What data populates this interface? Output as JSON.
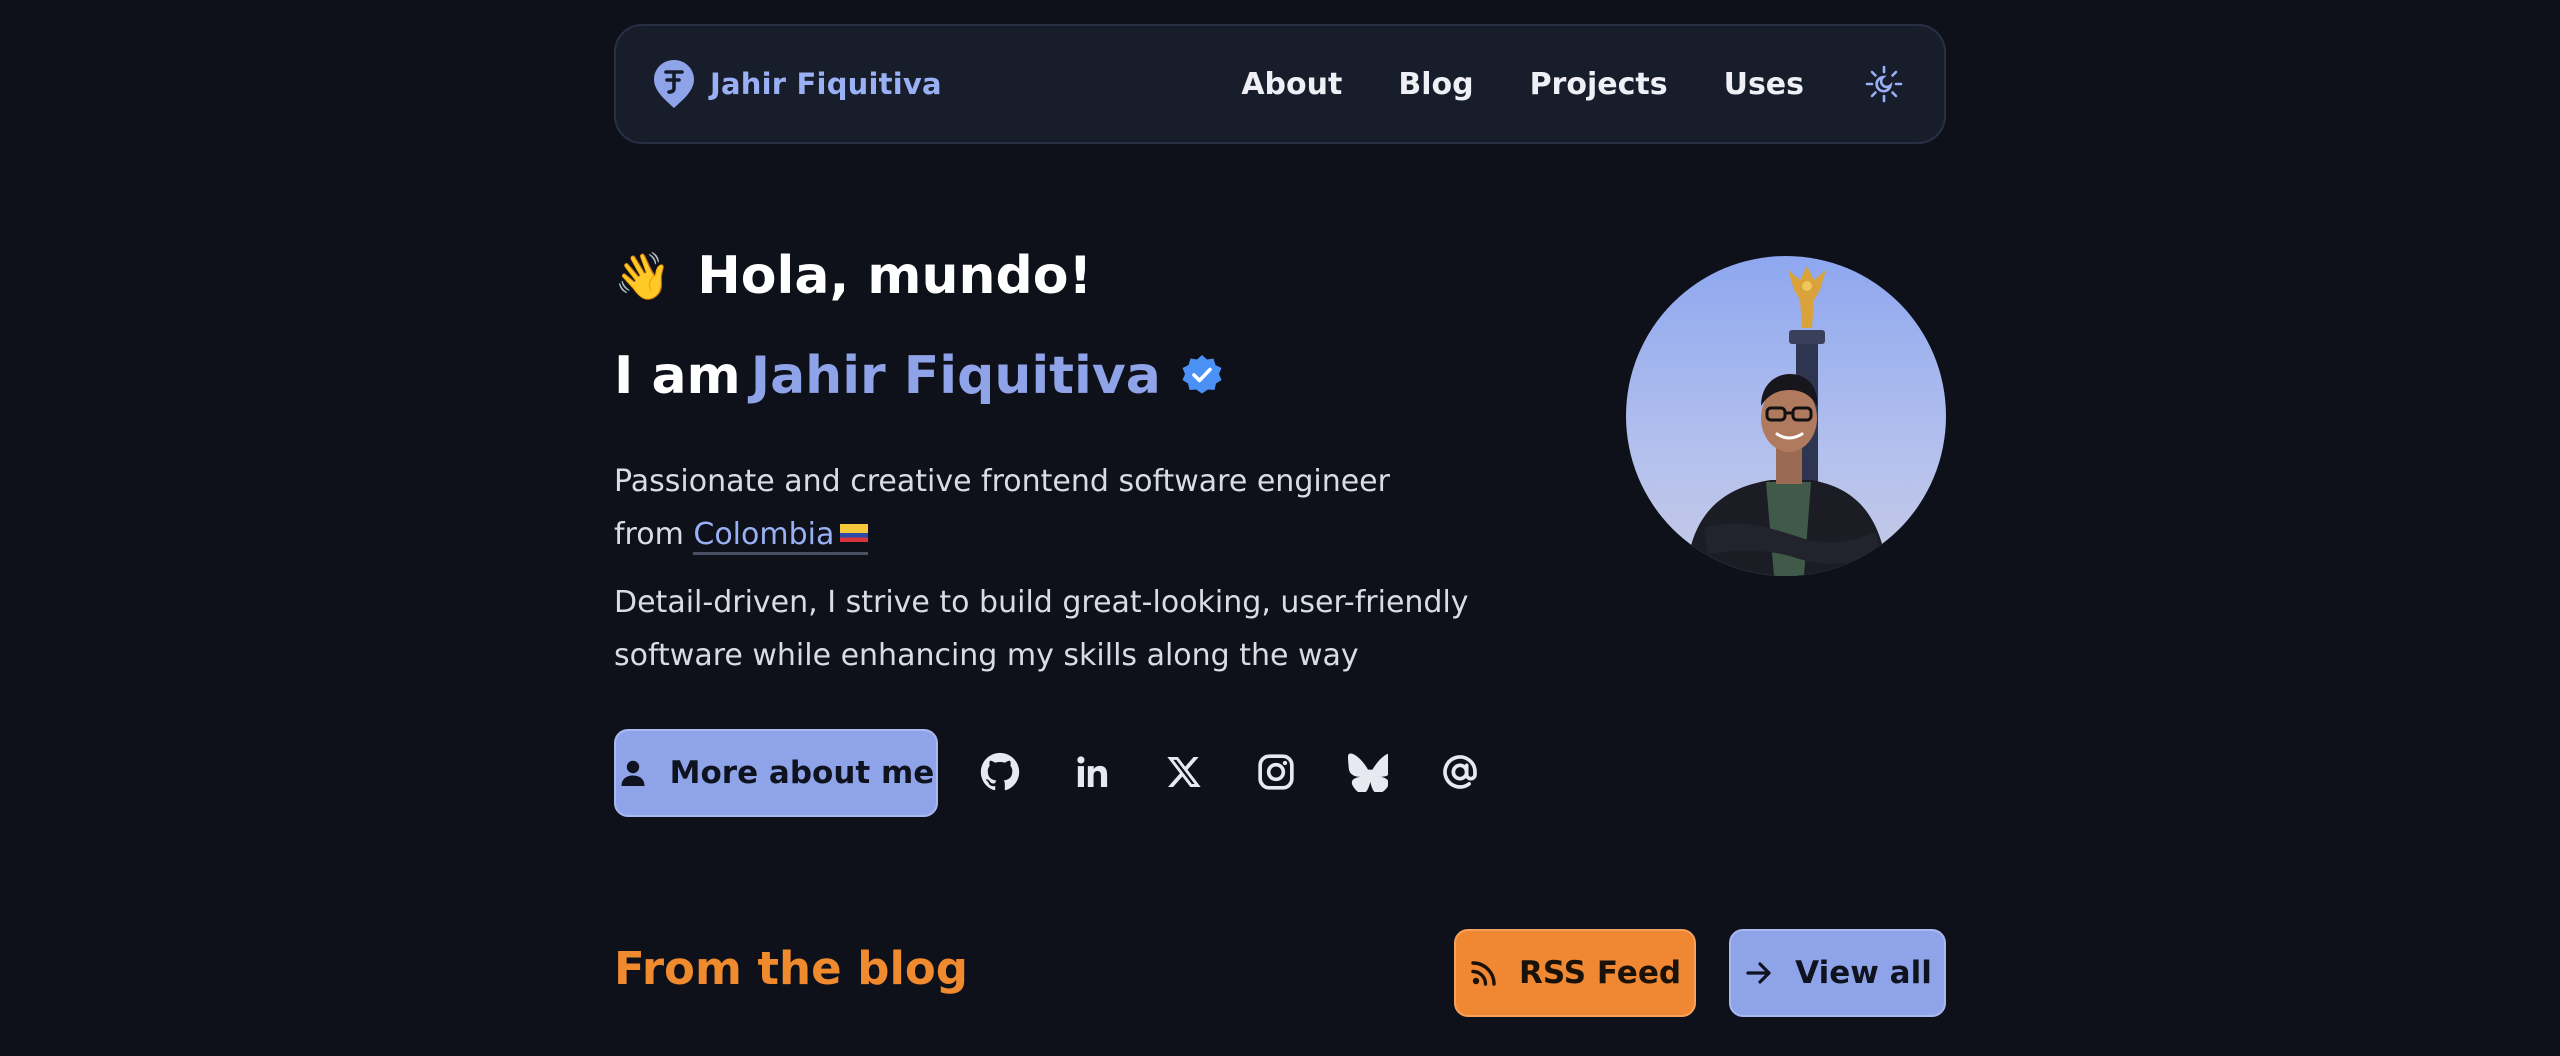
{
  "header": {
    "brand_name": "Jahir Fiquitiva",
    "nav": [
      "About",
      "Blog",
      "Projects",
      "Uses"
    ],
    "theme_toggle_icon": "theme-toggle-icon"
  },
  "hero": {
    "greeting_emoji": "👋",
    "greeting": "Hola, mundo!",
    "iam_prefix": "I am",
    "name": "Jahir Fiquitiva",
    "bio1_line1": "Passionate and creative frontend software engineer",
    "bio1_from": "from",
    "country": "Colombia",
    "bio2_line1": "Detail-driven, I strive to build great-looking, user-friendly",
    "bio2_line2": "software while enhancing my skills along the way",
    "more_button": "More about me"
  },
  "socials": [
    "github-icon",
    "linkedin-icon",
    "x-icon",
    "instagram-icon",
    "bluesky-icon",
    "email-at-icon"
  ],
  "blog": {
    "title": "From the blog",
    "rss_button": "RSS Feed",
    "view_all_button": "View all"
  },
  "colors": {
    "background": "#0e111a",
    "accent": "#8fa4e8",
    "orange": "#ef8733"
  }
}
